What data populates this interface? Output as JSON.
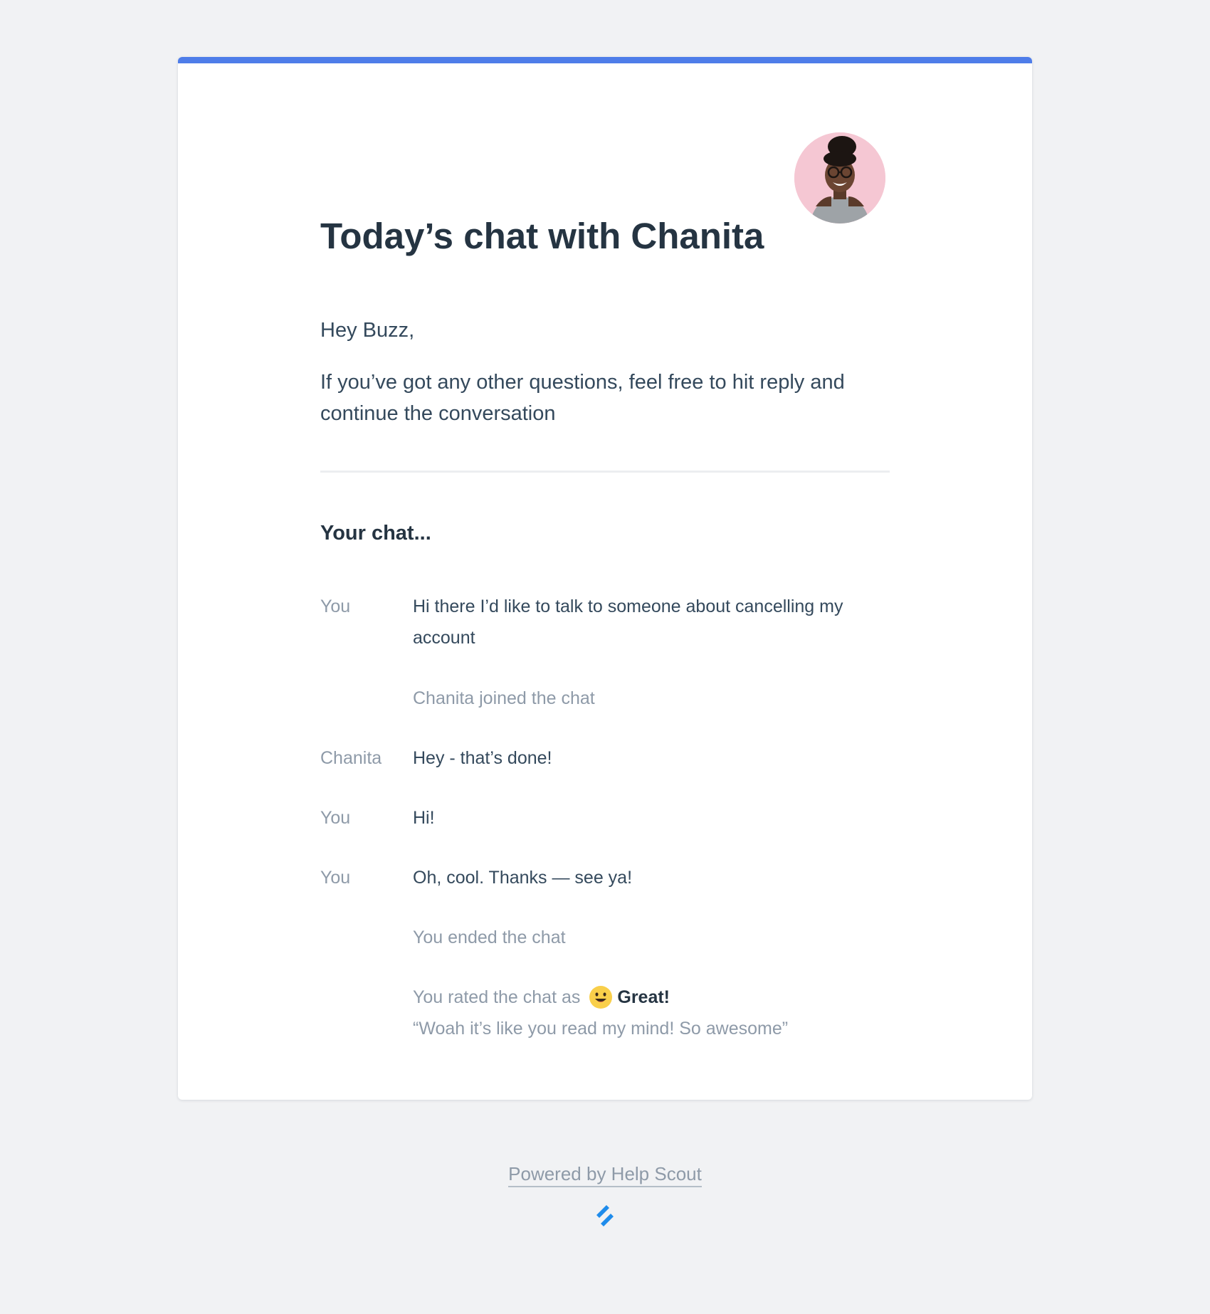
{
  "colors": {
    "page_background": "#f1f2f4",
    "card_background": "#ffffff",
    "accent_bar": "#4e7de9",
    "heading_text": "#253442",
    "body_text": "#34495c",
    "muted_text": "#8e9aa8",
    "logo_blue": "#1f8ceb"
  },
  "email": {
    "title": "Today’s chat with Chanita",
    "avatar_icon": "agent-avatar",
    "greeting": "Hey Buzz,",
    "intro": "If you’ve got any other questions, feel free to hit reply and continue the conversation"
  },
  "chat": {
    "heading": "Your chat...",
    "messages": [
      {
        "sender": "You",
        "text": "Hi there I’d like to talk to someone about cancelling my account"
      },
      {
        "sender": "",
        "text": "Chanita joined the chat"
      },
      {
        "sender": "Chanita",
        "text": "Hey - that’s done!"
      },
      {
        "sender": "You",
        "text": "Hi!"
      },
      {
        "sender": "You",
        "text": "Oh, cool. Thanks — see ya!"
      },
      {
        "sender": "",
        "text": "You ended the chat"
      }
    ],
    "rating": {
      "prefix": "You rated the chat as",
      "emoji_icon": "smiley-face-icon",
      "value": "Great!",
      "comment": "“Woah it’s like you read my mind! So awesome”"
    }
  },
  "footer": {
    "link_text": "Powered by Help Scout",
    "logo_icon": "help-scout-logo-icon"
  }
}
